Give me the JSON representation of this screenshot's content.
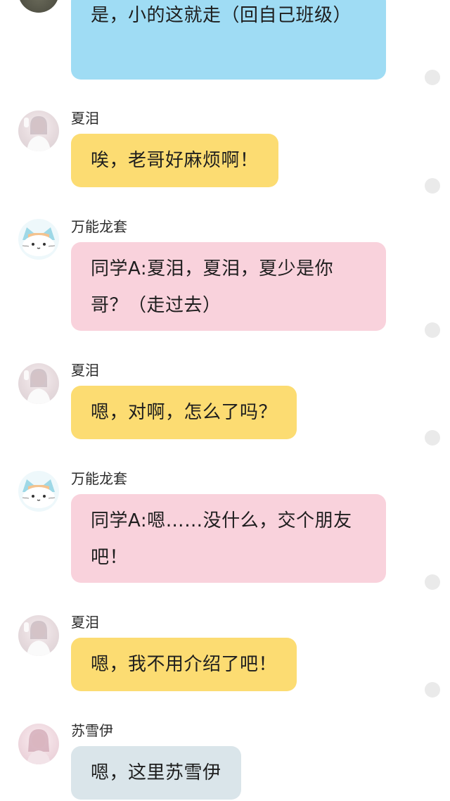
{
  "messages": [
    {
      "sender": "",
      "text": "是，小的这就走（回自己班级）"
    },
    {
      "sender": "夏泪",
      "text": "唉，老哥好麻烦啊！"
    },
    {
      "sender": "万能龙套",
      "text": "同学A:夏泪，夏泪，夏少是你哥？（走过去）"
    },
    {
      "sender": "夏泪",
      "text": "嗯，对啊，怎么了吗？"
    },
    {
      "sender": "万能龙套",
      "text": "同学A:嗯……没什么，交个朋友吧！"
    },
    {
      "sender": "夏泪",
      "text": "嗯，我不用介绍了吧！"
    },
    {
      "sender": "苏雪伊",
      "text": "嗯，这里苏雪伊"
    }
  ],
  "colors": {
    "bubble_blue": "#9fdcf4",
    "bubble_yellow": "#fcdc72",
    "bubble_pink": "#f9d2dc",
    "bubble_grey": "#dae5ea"
  }
}
